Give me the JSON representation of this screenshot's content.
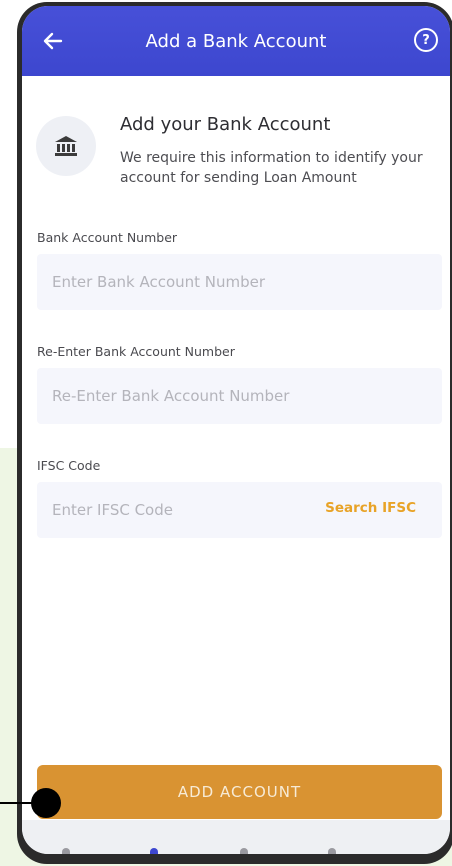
{
  "header": {
    "title": "Add a Bank Account",
    "back_icon": "arrow-left-icon",
    "help_icon": "help-circle-icon"
  },
  "intro": {
    "icon": "bank-icon",
    "title": "Add your Bank Account",
    "description": "We require this information to identify your account for sending Loan Amount"
  },
  "form": {
    "account_number": {
      "label": "Bank Account Number",
      "placeholder": "Enter Bank Account Number",
      "value": ""
    },
    "reenter_account_number": {
      "label": "Re-Enter Bank Account Number",
      "placeholder": "Re-Enter Bank Account Number",
      "value": ""
    },
    "ifsc": {
      "label": "IFSC Code",
      "placeholder": "Enter IFSC Code",
      "value": "",
      "search_label": "Search IFSC"
    }
  },
  "actions": {
    "add_account_label": "ADD ACCOUNT"
  },
  "colors": {
    "header": "#4049d3",
    "accent": "#e8a327",
    "button": "#d99332"
  }
}
